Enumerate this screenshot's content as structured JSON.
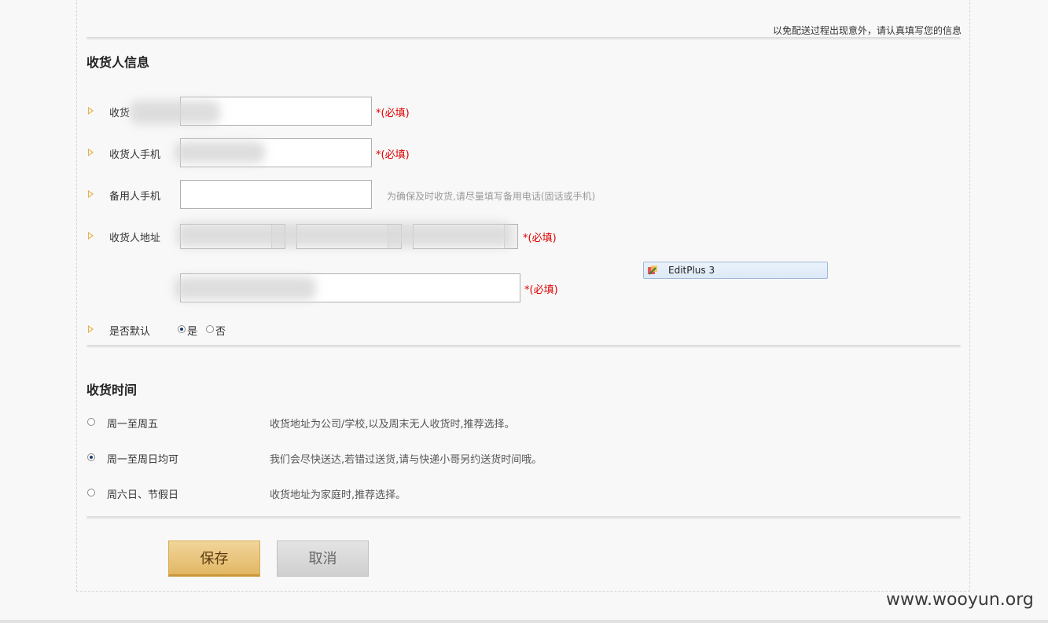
{
  "notice": "以免配送过程出现意外，请认真填写您的信息",
  "receiver_section": {
    "title": "收货人信息",
    "name_label": "收货",
    "mobile_label": "收货人手机",
    "backup_mobile_label": "备用人手机",
    "backup_hint": "为确保及时收货,请尽量填写备用电话(固话或手机)",
    "address_label": "收货人地址",
    "default_label": "是否默认",
    "default_yes": "是",
    "default_no": "否",
    "required_text": "*(必填)"
  },
  "popup": {
    "label": "EditPlus 3"
  },
  "delivery_section": {
    "title": "收货时间",
    "options": [
      {
        "label": "周一至周五",
        "desc": "收货地址为公司/学校,以及周末无人收货时,推荐选择。",
        "checked": false
      },
      {
        "label": "周一至周日均可",
        "desc": "我们会尽快送达,若错过送货,请与快递小哥另约送货时间哦。",
        "checked": true
      },
      {
        "label": "周六日、节假日",
        "desc": "收货地址为家庭时,推荐选择。",
        "checked": false
      }
    ]
  },
  "buttons": {
    "save": "保存",
    "cancel": "取消"
  },
  "watermark": "www.wooyun.org",
  "colors": {
    "accent": "#e2b765",
    "required": "#e00000",
    "radio": "#1c3e6e"
  }
}
